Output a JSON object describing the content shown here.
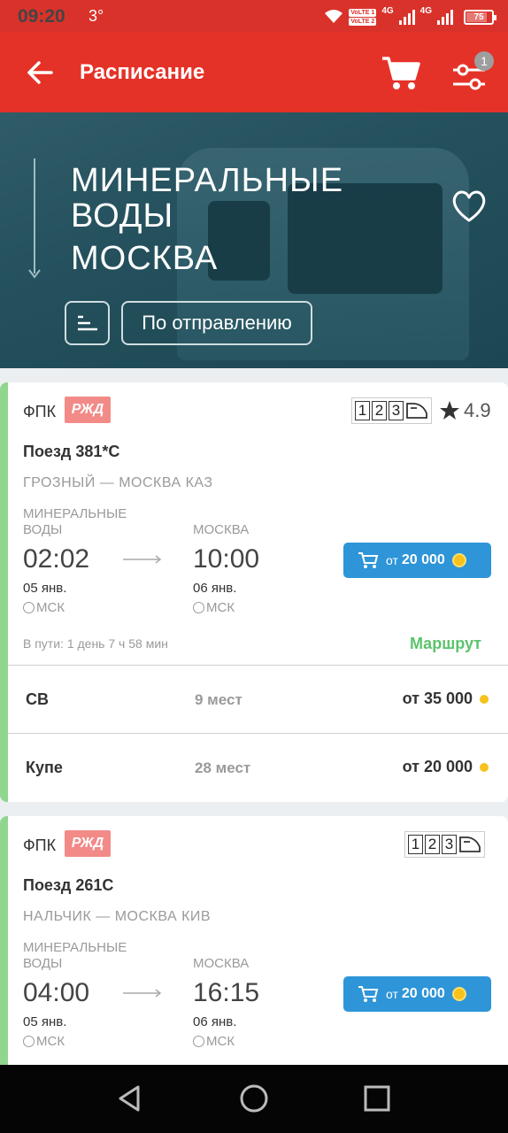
{
  "status_bar": {
    "time": "09:20",
    "temperature": "3°",
    "network": "4G",
    "battery": "75"
  },
  "app_bar": {
    "title": "Расписание",
    "filter_badge": "1"
  },
  "hero": {
    "from_line1": "МИНЕРАЛЬНЫЕ",
    "from_line2": "ВОДЫ",
    "to": "МОСКВА",
    "sort_button": "По отправлению"
  },
  "trains": [
    {
      "carrier": "ФПК",
      "carrier_logo": "РЖД",
      "classes": [
        "1",
        "2",
        "3"
      ],
      "rating": "4.9",
      "number": "Поезд 381*С",
      "route": "ГРОЗНЫЙ — МОСКВА КАЗ",
      "dep_station_line1": "МИНЕРАЛЬНЫЕ",
      "dep_station_line2": "ВОДЫ",
      "arr_station": "МОСКВА",
      "dep_time": "02:02",
      "arr_time": "10:00",
      "dep_date": "05 янв.",
      "arr_date": "06 янв.",
      "dep_tz": "МСК",
      "arr_tz": "МСК",
      "price_from": "от",
      "price": "20 000",
      "duration": "В пути: 1 день 7 ч 58 мин",
      "route_link": "Маршрут",
      "seats": [
        {
          "type": "СВ",
          "count": "9 мест",
          "price": "от 35 000"
        },
        {
          "type": "Купе",
          "count": "28 мест",
          "price": "от 20 000"
        }
      ]
    },
    {
      "carrier": "ФПК",
      "carrier_logo": "РЖД",
      "classes": [
        "1",
        "2",
        "3"
      ],
      "number": "Поезд 261С",
      "route": "НАЛЬЧИК — МОСКВА КИВ",
      "dep_station_line1": "МИНЕРАЛЬНЫЕ",
      "dep_station_line2": "ВОДЫ",
      "arr_station": "МОСКВА",
      "dep_time": "04:00",
      "arr_time": "16:15",
      "dep_date": "05 янв.",
      "arr_date": "06 янв.",
      "dep_tz": "МСК",
      "arr_tz": "МСК",
      "price_from": "от",
      "price": "20 000"
    }
  ],
  "colors": {
    "brand_red": "#e53228",
    "buy_blue": "#2e95d8",
    "route_green": "#5bc36c",
    "accent_stripe": "#8fd68f"
  }
}
